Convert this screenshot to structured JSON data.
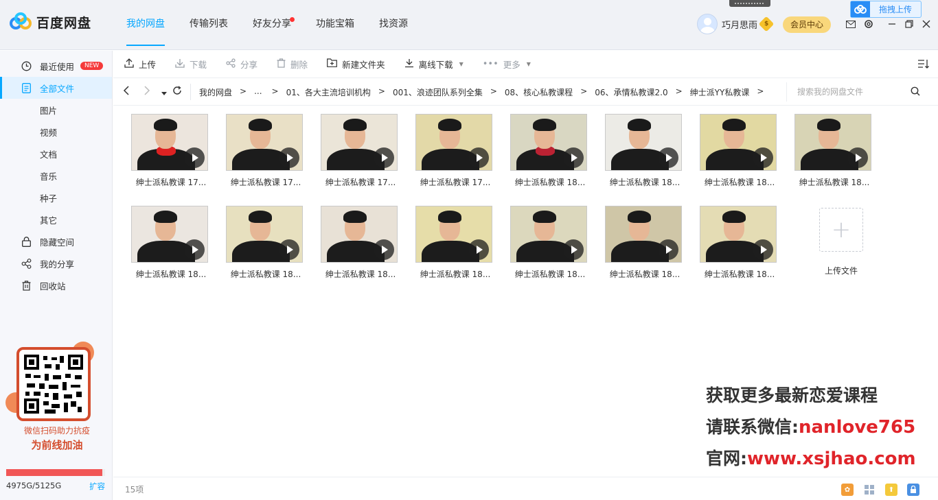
{
  "app": {
    "name": "百度网盘"
  },
  "nav": {
    "items": [
      {
        "label": "我的网盘",
        "active": true
      },
      {
        "label": "传输列表"
      },
      {
        "label": "好友分享",
        "dot": true
      },
      {
        "label": "功能宝箱"
      },
      {
        "label": "找资源"
      }
    ]
  },
  "user": {
    "name": "巧月思雨",
    "vip_symbol": "$",
    "member_center": "会员中心"
  },
  "drag_upload": "拖拽上传",
  "sidebar": {
    "items": [
      {
        "label": "最近使用",
        "badge": "NEW",
        "icon": "clock-icon"
      },
      {
        "label": "全部文件",
        "icon": "file-icon",
        "active": true
      },
      {
        "label": "图片",
        "sub": true
      },
      {
        "label": "视频",
        "sub": true
      },
      {
        "label": "文档",
        "sub": true
      },
      {
        "label": "音乐",
        "sub": true
      },
      {
        "label": "种子",
        "sub": true
      },
      {
        "label": "其它",
        "sub": true
      },
      {
        "label": "隐藏空间",
        "icon": "lock-icon"
      },
      {
        "label": "我的分享",
        "icon": "share-icon"
      },
      {
        "label": "回收站",
        "icon": "trash-icon"
      }
    ],
    "promo": {
      "line1": "微信扫码助力抗疫",
      "line2": "为前线加油"
    },
    "quota": {
      "text": "4975G/5125G",
      "used_fraction": 0.971,
      "expand": "扩容"
    }
  },
  "toolbar": {
    "upload": "上传",
    "download": "下载",
    "share": "分享",
    "delete": "删除",
    "new_folder": "新建文件夹",
    "offline_download": "离线下载",
    "more": "更多"
  },
  "path": {
    "crumbs": [
      "我的网盘",
      "...",
      "01、各大主流培训机构",
      "001、浪迹团队系列全集",
      "08、核心私教课程",
      "06、承情私教课2.0",
      "绅士派YY私教课"
    ],
    "sep": ">",
    "search_placeholder": "搜索我的网盘文件"
  },
  "files": [
    {
      "name": "绅士派私教课 17...",
      "wall": "#ece5dd",
      "scarf": "#d22"
    },
    {
      "name": "绅士派私教课 17...",
      "wall": "#e9e0c6"
    },
    {
      "name": "绅士派私教课 17...",
      "wall": "#ebe5d8"
    },
    {
      "name": "绅士派私教课 17...",
      "wall": "#e3d9a8"
    },
    {
      "name": "绅士派私教课 18...",
      "wall": "#d9d7c2",
      "scarf": "#b23"
    },
    {
      "name": "绅士派私教课 18...",
      "wall": "#ecebe6"
    },
    {
      "name": "绅士派私教课 18...",
      "wall": "#e2d9a2"
    },
    {
      "name": "绅士派私教课 18...",
      "wall": "#d8d4b5"
    },
    {
      "name": "绅士派私教课 18...",
      "wall": "#ebe6e0"
    },
    {
      "name": "绅士派私教课 18...",
      "wall": "#e7e0bf"
    },
    {
      "name": "绅士派私教课 18...",
      "wall": "#e8e1d6"
    },
    {
      "name": "绅士派私教课 18...",
      "wall": "#e6dda9"
    },
    {
      "name": "绅士派私教课 18...",
      "wall": "#dcd8bd"
    },
    {
      "name": "绅士派私教课 18...",
      "wall": "#cfc6a7"
    },
    {
      "name": "绅士派私教课 18...",
      "wall": "#e4dcb4"
    }
  ],
  "upload_tile": "上传文件",
  "watermark": {
    "line1": "获取更多最新恋爱课程",
    "line2_label": "请联系微信:",
    "line2_value": "nanlove765",
    "line3_label": "官网:",
    "line3_value": "www.xsjhao.com"
  },
  "status": {
    "count": "15项"
  }
}
